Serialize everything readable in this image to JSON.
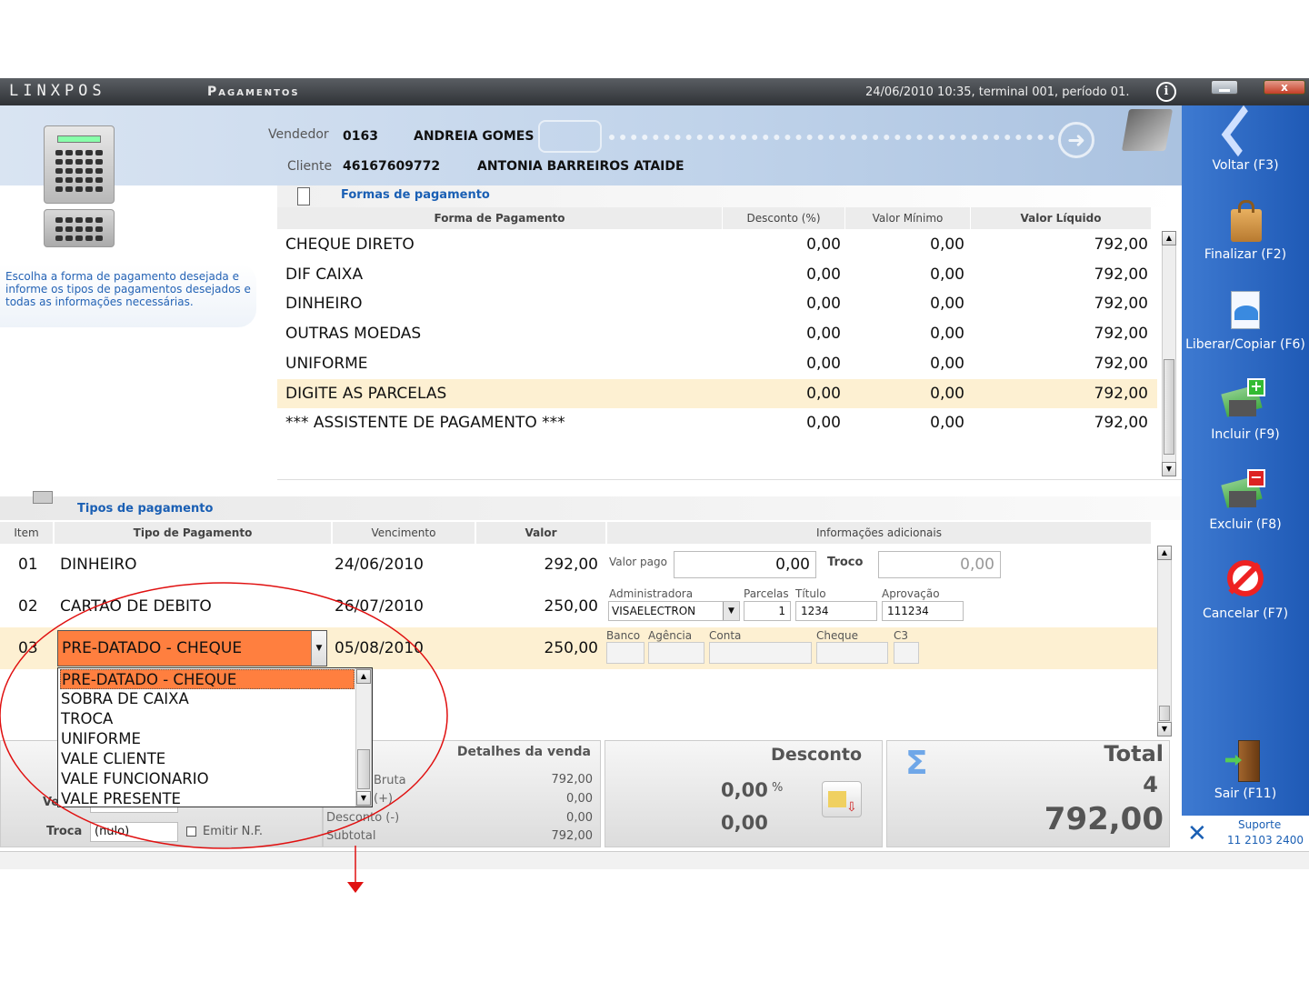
{
  "window": {
    "logo": "LINXPOS",
    "title": "Pagamentos",
    "status": "24/06/2010 10:35, terminal 001, período 01.",
    "info_icon": "info-icon",
    "close_label": "x"
  },
  "header": {
    "vendedor_label": "Vendedor",
    "vendedor_code": "0163",
    "vendedor_name": "ANDREIA GOMES",
    "cliente_label": "Cliente",
    "cliente_code": "46167609772",
    "cliente_name": "ANTONIA BARREIROS ATAIDE"
  },
  "hint": "Escolha a forma de pagamento desejada e informe os tipos de pagamentos desejados e todas as informações necessárias.",
  "formas": {
    "title": "Formas de pagamento",
    "columns": [
      "Forma de Pagamento",
      "Desconto (%)",
      "Valor Mínimo",
      "Valor Líquido"
    ],
    "rows": [
      {
        "forma": "CHEQUE DIRETO",
        "desconto": "0,00",
        "minimo": "0,00",
        "liquido": "792,00"
      },
      {
        "forma": "DIF CAIXA",
        "desconto": "0,00",
        "minimo": "0,00",
        "liquido": "792,00"
      },
      {
        "forma": "DINHEIRO",
        "desconto": "0,00",
        "minimo": "0,00",
        "liquido": "792,00"
      },
      {
        "forma": "OUTRAS MOEDAS",
        "desconto": "0,00",
        "minimo": "0,00",
        "liquido": "792,00"
      },
      {
        "forma": "UNIFORME",
        "desconto": "0,00",
        "minimo": "0,00",
        "liquido": "792,00"
      },
      {
        "forma": "DIGITE AS PARCELAS",
        "desconto": "0,00",
        "minimo": "0,00",
        "liquido": "792,00"
      },
      {
        "forma": "*** ASSISTENTE DE PAGAMENTO ***",
        "desconto": "0,00",
        "minimo": "0,00",
        "liquido": "792,00"
      }
    ],
    "selected_index": 5
  },
  "tipos": {
    "title": "Tipos de pagamento",
    "columns": [
      "Item",
      "Tipo de Pagamento",
      "Vencimento",
      "Valor",
      "Informações adicionais"
    ],
    "rows": [
      {
        "item": "01",
        "tipo": "DINHEIRO",
        "vencimento": "24/06/2010",
        "valor": "292,00"
      },
      {
        "item": "02",
        "tipo": "CARTAO DE DEBITO",
        "vencimento": "26/07/2010",
        "valor": "250,00"
      },
      {
        "item": "03",
        "tipo": "PRE-DATADO - CHEQUE",
        "vencimento": "05/08/2010",
        "valor": "250,00"
      }
    ],
    "row1_info": {
      "valor_pago_label": "Valor pago",
      "valor_pago": "0,00",
      "troco_label": "Troco",
      "troco": "0,00"
    },
    "row2_info": {
      "administradora_label": "Administradora",
      "administradora": "VISAELECTRON",
      "parcelas_label": "Parcelas",
      "parcelas": "1",
      "titulo_label": "Título",
      "titulo": "1234",
      "aprovacao_label": "Aprovação",
      "aprovacao": "111234"
    },
    "row3_info": {
      "banco_label": "Banco",
      "agencia_label": "Agência",
      "conta_label": "Conta",
      "cheque_label": "Cheque",
      "c3_label": "C3"
    }
  },
  "dropdown": {
    "selected": "PRE-DATADO - CHEQUE",
    "options": [
      "PRE-DATADO - CHEQUE",
      "SOBRA DE CAIXA",
      "TROCA",
      "UNIFORME",
      "VALE CLIENTE",
      "VALE FUNCIONARIO",
      "VALE PRESENTE"
    ]
  },
  "footer": {
    "venda_label": "Venda",
    "venda_value": "(nulo)",
    "troca_label": "Troca",
    "troca_value": "(nulo)",
    "emitir_nf": "Emitir N.F.",
    "detalhes_title": "Detalhes da venda",
    "bruta_label": "Bruta",
    "bruta": "792,00",
    "row2_label": "(+)",
    "row2": "0,00",
    "desconto_label": "Desconto (-)",
    "desconto": "0,00",
    "subtotal_label": "Subtotal",
    "subtotal": "792,00",
    "desconto_title": "Desconto",
    "desconto_pct": "0,00",
    "pct_sign": "%",
    "desconto_valor": "0,00",
    "total_title": "Total",
    "total_items": "4",
    "total_value": "792,00",
    "sigma": "Σ"
  },
  "sidebar": {
    "buttons": [
      {
        "label": "Voltar (F3)",
        "icon": "back-arrows-icon"
      },
      {
        "label": "Finalizar (F2)",
        "icon": "shopping-bag-icon"
      },
      {
        "label": "Liberar/Copiar (F6)",
        "icon": "document-copy-icon"
      },
      {
        "label": "Incluir (F9)",
        "icon": "money-add-icon"
      },
      {
        "label": "Excluir (F8)",
        "icon": "money-remove-icon"
      },
      {
        "label": "Cancelar (F7)",
        "icon": "cancel-icon"
      },
      {
        "label": "Sair (F11)",
        "icon": "exit-door-icon"
      }
    ],
    "suporte_label": "Suporte",
    "suporte_phone": "11 2103 2400"
  },
  "colors": {
    "accent_orange": "#ff7f3f",
    "highlight_row": "#fdf0d2",
    "sidebar_blue": "#2a66c2",
    "annotation_red": "#e01010"
  }
}
